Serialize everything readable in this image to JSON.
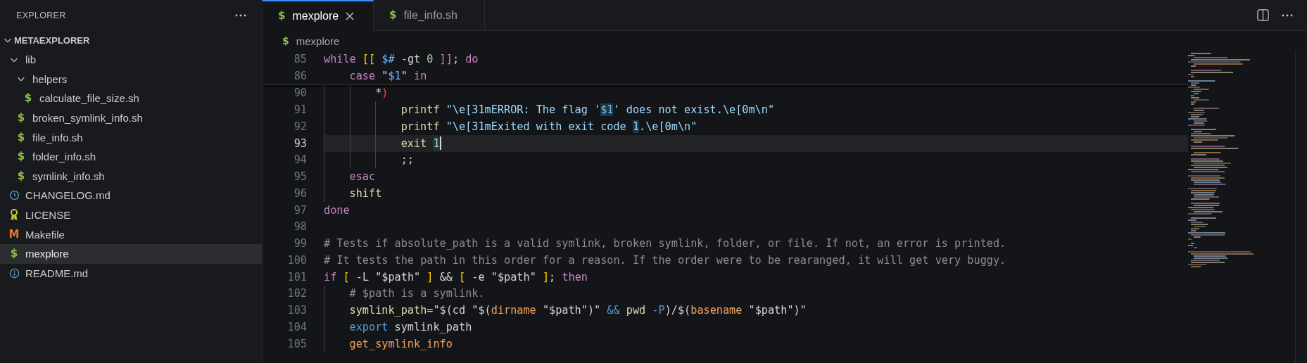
{
  "sidebar": {
    "title": "EXPLORER",
    "root": {
      "label": "METAEXPLORER",
      "expanded": true,
      "children": [
        {
          "kind": "folder",
          "label": "lib",
          "expanded": true,
          "selected": false,
          "children": [
            {
              "kind": "folder",
              "label": "helpers",
              "expanded": true,
              "selected": false,
              "children": [
                {
                  "kind": "script",
                  "icon": "$",
                  "label": "calculate_file_size.sh",
                  "selected": false
                }
              ]
            },
            {
              "kind": "script",
              "icon": "$",
              "label": "broken_symlink_info.sh",
              "selected": false
            },
            {
              "kind": "script",
              "icon": "$",
              "label": "file_info.sh",
              "selected": false
            },
            {
              "kind": "script",
              "icon": "$",
              "label": "folder_info.sh",
              "selected": false
            },
            {
              "kind": "script",
              "icon": "$",
              "label": "symlink_info.sh",
              "selected": false
            }
          ]
        },
        {
          "kind": "history",
          "label": "CHANGELOG.md",
          "selected": false
        },
        {
          "kind": "license",
          "label": "LICENSE",
          "selected": false
        },
        {
          "kind": "makefile",
          "icon": "M",
          "label": "Makefile",
          "selected": false
        },
        {
          "kind": "script",
          "icon": "$",
          "label": "mexplore",
          "selected": true
        },
        {
          "kind": "info",
          "label": "README.md",
          "selected": false
        }
      ]
    }
  },
  "tabs": [
    {
      "icon": "$",
      "label": "mexplore",
      "selected": true
    },
    {
      "icon": "$",
      "label": "file_info.sh",
      "selected": false
    }
  ],
  "breadcrumb": {
    "icon": "$",
    "label": "mexplore"
  },
  "code": {
    "sticky": [
      {
        "number": "85",
        "current": false,
        "tokens": [
          {
            "kind": "kw",
            "text": "while"
          },
          {
            "kind": "b1",
            "text": " [["
          },
          {
            "kind": "var",
            "text": " $#"
          },
          {
            "kind": "plain",
            "text": " -gt "
          },
          {
            "kind": "num",
            "text": "0"
          },
          {
            "kind": "b2",
            "text": " ]]"
          },
          {
            "kind": "plain",
            "text": "; "
          },
          {
            "kind": "kw",
            "text": "do"
          }
        ]
      },
      {
        "number": "86",
        "current": false,
        "tokens": [
          {
            "kind": "kw",
            "text": "    case"
          },
          {
            "kind": "plain",
            "text": " \""
          },
          {
            "kind": "var",
            "text": "$1"
          },
          {
            "kind": "plain",
            "text": "\" "
          },
          {
            "kind": "kw",
            "text": "in"
          }
        ]
      }
    ],
    "lines": [
      {
        "number": "90",
        "current": false,
        "tokens": [
          {
            "kind": "plain",
            "text": "        *"
          },
          {
            "kind": "err",
            "text": ")"
          }
        ]
      },
      {
        "number": "91",
        "current": false,
        "tokens": [
          {
            "kind": "cmd",
            "text": "            printf"
          },
          {
            "kind": "str",
            "text": " \"\\e[31mERROR: The flag '"
          },
          {
            "kind": "var-hl",
            "text": "$1"
          },
          {
            "kind": "str",
            "text": "' does not exist.\\e[0m\\n\""
          }
        ]
      },
      {
        "number": "92",
        "current": false,
        "tokens": [
          {
            "kind": "cmd",
            "text": "            printf"
          },
          {
            "kind": "str",
            "text": " \"\\e[31mExited with exit code "
          },
          {
            "kind": "str-hl",
            "text": "1"
          },
          {
            "kind": "str",
            "text": ".\\e[0m\\n\""
          }
        ]
      },
      {
        "number": "93",
        "current": true,
        "tokens": [
          {
            "kind": "cmd",
            "text": "            exit "
          },
          {
            "kind": "num-hl",
            "text": "1"
          }
        ]
      },
      {
        "number": "94",
        "current": false,
        "tokens": [
          {
            "kind": "plain",
            "text": "            ;;"
          }
        ]
      },
      {
        "number": "95",
        "current": false,
        "tokens": [
          {
            "kind": "kw",
            "text": "    esac"
          }
        ]
      },
      {
        "number": "96",
        "current": false,
        "tokens": [
          {
            "kind": "cmd",
            "text": "    shift"
          }
        ]
      },
      {
        "number": "97",
        "current": false,
        "tokens": [
          {
            "kind": "kw",
            "text": "done"
          }
        ]
      },
      {
        "number": "98",
        "current": false
      },
      {
        "number": "99",
        "current": false,
        "tokens": [
          {
            "kind": "comment",
            "text": "# Tests if absolute_path is a valid symlink, broken symlink, folder, or file. If not, an error is printed."
          }
        ]
      },
      {
        "number": "100",
        "current": false,
        "tokens": [
          {
            "kind": "comment",
            "text": "# It tests the path in this order for a reason. If the order were to be rearanged, it will get very buggy."
          }
        ]
      },
      {
        "number": "101",
        "current": false,
        "tokens": [
          {
            "kind": "kw",
            "text": "if"
          },
          {
            "kind": "b1",
            "text": " ["
          },
          {
            "kind": "plain",
            "text": " -L \"$path\" "
          },
          {
            "kind": "b1",
            "text": "]"
          },
          {
            "kind": "plain",
            "text": " && "
          },
          {
            "kind": "b1",
            "text": "["
          },
          {
            "kind": "plain",
            "text": " -e \"$path\" "
          },
          {
            "kind": "b1",
            "text": "]"
          },
          {
            "kind": "plain",
            "text": "; "
          },
          {
            "kind": "kw",
            "text": "then"
          }
        ]
      },
      {
        "number": "102",
        "current": false,
        "tokens": [
          {
            "kind": "comment",
            "text": "    # $path is a symlink."
          }
        ]
      },
      {
        "number": "103",
        "current": false,
        "tokens": [
          {
            "kind": "cmd",
            "text": "    symlink_path"
          },
          {
            "kind": "plain",
            "text": "=\"$(cd \"$("
          },
          {
            "kind": "fn",
            "text": "dirname"
          },
          {
            "kind": "plain",
            "text": " \"$path\")\" "
          },
          {
            "kind": "blue",
            "text": "&&"
          },
          {
            "kind": "cmd",
            "text": " pwd"
          },
          {
            "kind": "blue",
            "text": " -P"
          },
          {
            "kind": "plain",
            "text": ")/$("
          },
          {
            "kind": "fn",
            "text": "basename"
          },
          {
            "kind": "plain",
            "text": " \"$path\")\""
          }
        ]
      },
      {
        "number": "104",
        "current": false,
        "tokens": [
          {
            "kind": "blue",
            "text": "    export"
          },
          {
            "kind": "plain",
            "text": " symlink_path"
          }
        ]
      },
      {
        "number": "105",
        "current": false,
        "tokens": [
          {
            "kind": "fn",
            "text": "    get_symlink_info"
          }
        ]
      }
    ]
  }
}
